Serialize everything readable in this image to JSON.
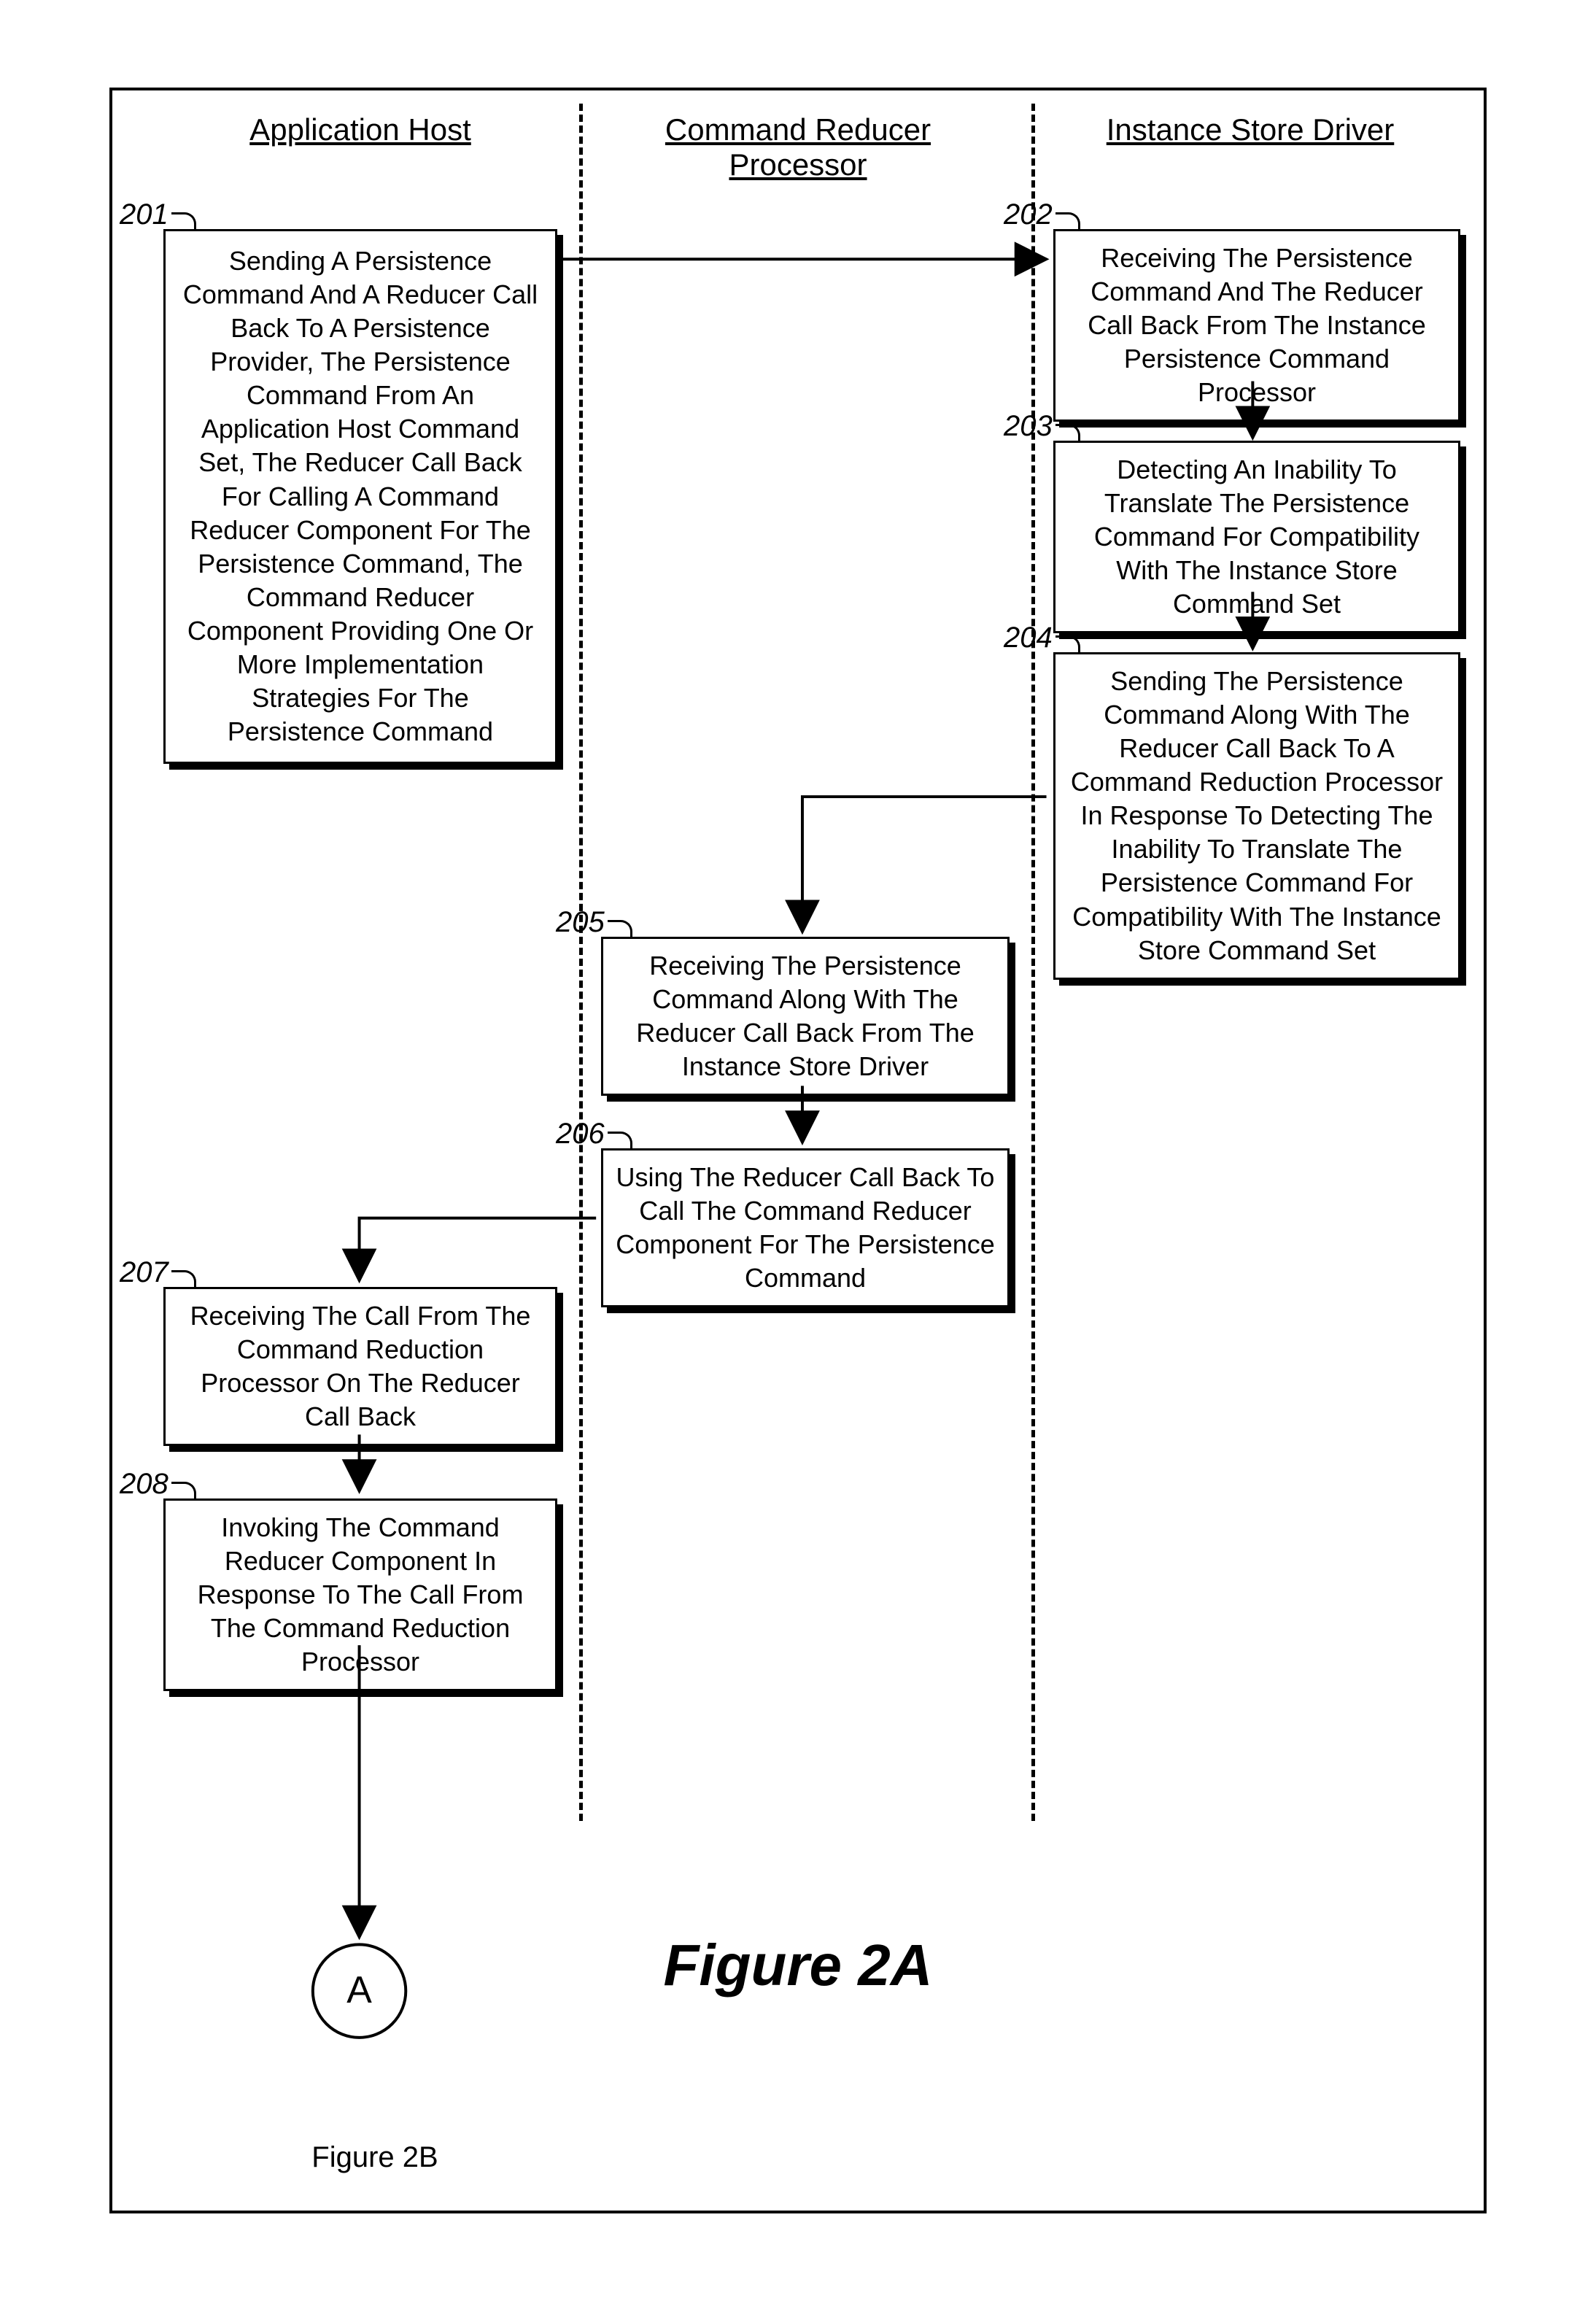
{
  "headings": {
    "app_host": "Application Host",
    "cmd_reducer": "Command Reducer Processor",
    "instance_store": "Instance Store Driver"
  },
  "steps": {
    "s201": {
      "num": "201",
      "text": "Sending A Persistence Command And A Reducer Call Back To A Persistence Provider, The Persistence Command From An Application Host Command Set, The Reducer Call Back For Calling A Command Reducer Component For The Persistence Command, The Command Reducer Component Providing One Or More Implementation Strategies For The Persistence Command"
    },
    "s202": {
      "num": "202",
      "text": "Receiving The Persistence Command And The Reducer Call Back From The Instance Persistence Command Processor"
    },
    "s203": {
      "num": "203",
      "text": "Detecting An Inability To Translate The Persistence Command For Compatibility With The Instance Store Command Set"
    },
    "s204": {
      "num": "204",
      "text": "Sending The Persistence Command Along With The Reducer Call Back To A Command Reduction Processor In Response To Detecting The Inability To Translate The Persistence Command For Compatibility With The Instance Store Command Set"
    },
    "s205": {
      "num": "205",
      "text": "Receiving The Persistence Command Along With The Reducer Call Back From The Instance Store Driver"
    },
    "s206": {
      "num": "206",
      "text": "Using The Reducer Call Back To Call The Command Reducer Component For The Persistence Command"
    },
    "s207": {
      "num": "207",
      "text": "Receiving The Call From The Command Reduction Processor On The Reducer Call Back"
    },
    "s208": {
      "num": "208",
      "text": "Invoking The Command Reducer Component In Response To The Call From The Command Reduction Processor"
    }
  },
  "labels": {
    "figure_main": "Figure 2A",
    "figure_next": "Figure 2B",
    "continuation_a": "A"
  }
}
